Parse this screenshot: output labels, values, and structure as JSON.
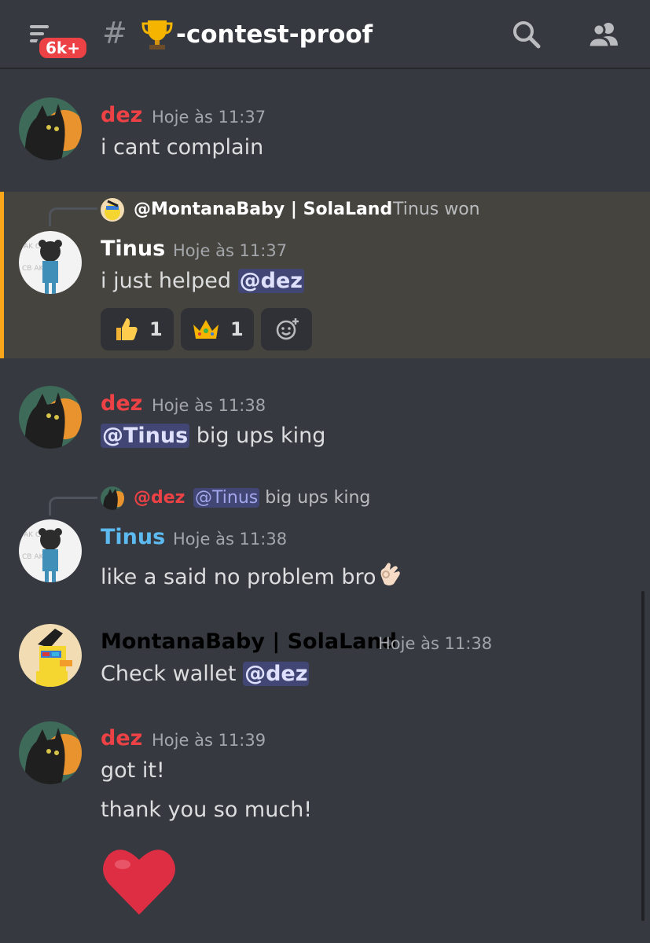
{
  "header": {
    "badge": "6k+",
    "hash": "#",
    "channel": "-contest-proof",
    "trophy_icon": "trophy-icon",
    "search_icon": "search-icon",
    "members_icon": "members-icon"
  },
  "messages": [
    {
      "author": "dez",
      "author_color": "#ed4245",
      "timestamp": "Hoje às 11:37",
      "text": "i cant complain"
    },
    {
      "reply": {
        "author": "@MontanaBaby | SolaLand",
        "text": "Tinus won"
      },
      "author": "Tinus",
      "author_color": "#ffffff",
      "timestamp": "Hoje às 11:37",
      "text_prefix": "i just helped ",
      "mention": "@dez",
      "reactions": [
        {
          "emoji": "thumbs-up-emoji",
          "count": "1"
        },
        {
          "emoji": "crown-emoji",
          "count": "1"
        },
        {
          "emoji": "add-reaction-icon"
        }
      ]
    },
    {
      "author": "dez",
      "author_color": "#ed4245",
      "timestamp": "Hoje às 11:38",
      "mention": "@Tinus",
      "text_suffix": " big ups king"
    },
    {
      "reply": {
        "author": "@dez",
        "mention": "@Tinus",
        "text": " big ups king"
      },
      "author": "Tinus",
      "author_color": "#5dbaf0",
      "timestamp": "Hoje às 11:38",
      "text": "like a said no problem bro",
      "emoji": "ok-hand-emoji"
    },
    {
      "author": "MontanaBaby | SolaLand",
      "author_color": "#000000",
      "timestamp": "Hoje às 11:38",
      "text_prefix": "Check wallet ",
      "mention": "@dez"
    },
    {
      "author": "dez",
      "author_color": "#ed4245",
      "timestamp": "Hoje às 11:39",
      "lines": [
        "got it!",
        "thank you so much!"
      ],
      "emoji": "red-heart-emoji"
    }
  ]
}
